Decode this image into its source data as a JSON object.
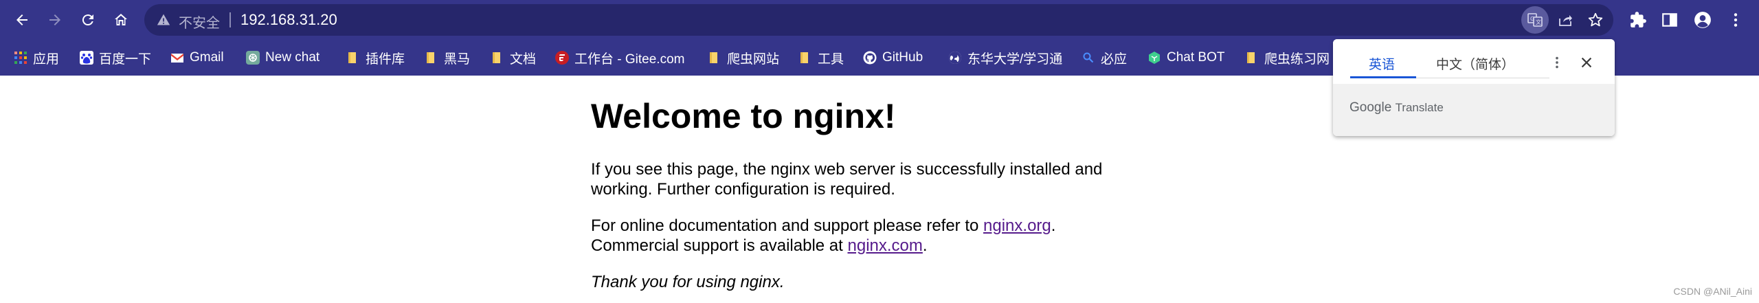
{
  "toolbar": {
    "security_label": "不安全",
    "url": "192.168.31.20"
  },
  "icons": {
    "back": "arrow-left-icon",
    "forward": "arrow-right-icon",
    "reload": "reload-icon",
    "home": "home-icon",
    "warning": "warning-triangle-icon",
    "translate": "translate-icon",
    "share": "share-icon",
    "bookmark": "star-icon",
    "extensions": "puzzle-icon",
    "sidepanel": "side-panel-icon",
    "profile": "profile-icon",
    "menu": "kebab-menu-icon"
  },
  "bookmarks": [
    {
      "label": "应用",
      "icon": "apps-grid-icon"
    },
    {
      "label": "百度一下",
      "icon": "baidu-icon"
    },
    {
      "label": "Gmail",
      "icon": "gmail-icon"
    },
    {
      "label": "New chat",
      "icon": "chatgpt-icon"
    },
    {
      "label": "插件库",
      "icon": "folder-icon"
    },
    {
      "label": "黑马",
      "icon": "folder-icon"
    },
    {
      "label": "文档",
      "icon": "folder-icon"
    },
    {
      "label": "工作台 - Gitee.com",
      "icon": "gitee-icon"
    },
    {
      "label": "爬虫网站",
      "icon": "folder-icon"
    },
    {
      "label": "工具",
      "icon": "folder-icon"
    },
    {
      "label": "GitHub",
      "icon": "github-icon"
    },
    {
      "label": "东华大学/学习通",
      "icon": "globe-icon"
    },
    {
      "label": "必应",
      "icon": "search-icon"
    },
    {
      "label": "Chat BOT",
      "icon": "chatbot-icon"
    },
    {
      "label": "爬虫练习网",
      "icon": "folder-icon"
    }
  ],
  "page": {
    "title": "Welcome to nginx!",
    "p1_line1": "If you see this page, the nginx web server is successfully installed and",
    "p1_line2": "working. Further configuration is required.",
    "p2_line1_prefix": "For online documentation and support please refer to ",
    "p2_link1": "nginx.org",
    "p2_line1_suffix": ".",
    "p2_line2_prefix": "Commercial support is available at ",
    "p2_link2": "nginx.com",
    "p2_line2_suffix": ".",
    "thanks": "Thank you for using nginx."
  },
  "translate_popup": {
    "source_lang": "英语",
    "target_lang": "中文（简体）",
    "brand_google": "Google",
    "brand_translate": "Translate"
  },
  "watermark": "CSDN @ANil_Aini",
  "colors": {
    "toolbar": "#35358a",
    "omnibox": "#26266b",
    "link": "#551a8b",
    "accent": "#1a56d6"
  }
}
